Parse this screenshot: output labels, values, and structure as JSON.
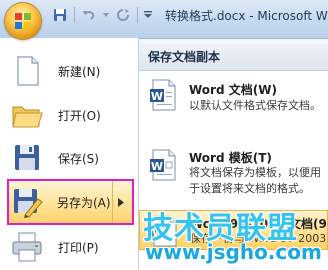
{
  "window": {
    "title": "转换格式.docx - Microsoft W"
  },
  "quick_access": {
    "buttons": [
      "save-icon",
      "undo-icon",
      "undo-dropdown-icon",
      "redo-icon"
    ]
  },
  "menu": {
    "items": [
      {
        "label": "新建(N)",
        "icon": "new-document-icon"
      },
      {
        "label": "打开(O)",
        "icon": "open-folder-icon"
      },
      {
        "label": "保存(S)",
        "icon": "save-disk-icon"
      },
      {
        "label": "另存为(A)",
        "icon": "save-as-icon",
        "selected": true
      },
      {
        "label": "打印(P)",
        "icon": "printer-icon"
      }
    ]
  },
  "submenu": {
    "header": "保存文档副本",
    "items": [
      {
        "title": "Word 文档(W)",
        "desc": "以默认文件格式保存文档。",
        "icon": "word-document-icon"
      },
      {
        "title": "Word 模板(T)",
        "desc": "将文档保存为模板，以便用于设置将来文档的格式。",
        "icon": "word-template-icon"
      },
      {
        "title": "Word 97-2003 文档(9)",
        "desc": "保存一份与 Word 97-2003",
        "icon": "word-97-document-icon",
        "highlighted": true
      }
    ]
  },
  "watermark": {
    "text": "技术员联盟",
    "url": "www.jsgho.com"
  },
  "colors": {
    "selection_border": "#e01ec8",
    "highlight": "#ffdf8d",
    "watermark": "#36c4ee"
  }
}
